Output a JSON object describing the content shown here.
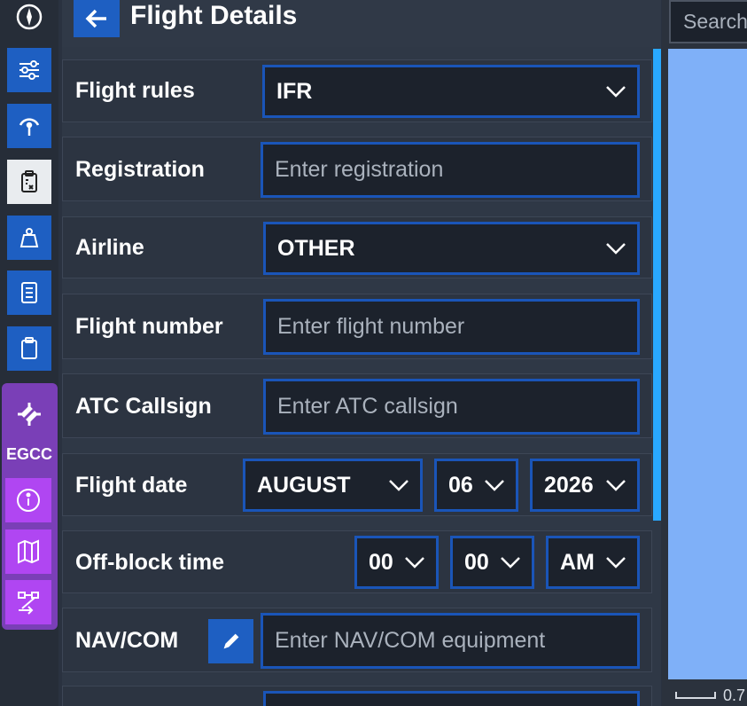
{
  "header": {
    "title": "Flight Details",
    "back_icon": "arrow-left-icon"
  },
  "rail": {
    "airport_code": "EGCC",
    "icons": [
      "compass-icon",
      "sliders-icon",
      "gauge-icon",
      "clipboard-x-icon",
      "weight-icon",
      "document-icon",
      "clipboard-icon",
      "runway-icon",
      "info-icon",
      "map-icon",
      "route-icon"
    ]
  },
  "form": {
    "flight_rules": {
      "label": "Flight rules",
      "value": "IFR"
    },
    "registration": {
      "label": "Registration",
      "placeholder": "Enter registration"
    },
    "airline": {
      "label": "Airline",
      "value": "OTHER"
    },
    "flight_number": {
      "label": "Flight number",
      "placeholder": "Enter flight number"
    },
    "atc_callsign": {
      "label": "ATC Callsign",
      "placeholder": "Enter ATC callsign"
    },
    "flight_date": {
      "label": "Flight date",
      "month": "AUGUST",
      "day": "06",
      "year": "2026"
    },
    "off_block_time": {
      "label": "Off-block time",
      "hour": "00",
      "minute": "00",
      "ampm": "AM"
    },
    "nav_com": {
      "label": "NAV/COM",
      "placeholder": "Enter NAV/COM equipment"
    }
  },
  "map": {
    "search_placeholder": "Search",
    "scale_text": "0.7"
  },
  "colors": {
    "accent": "#1e5fc2",
    "purple": "#b046f2",
    "scroll": "#29a8ff",
    "map": "#7fb0f8"
  }
}
